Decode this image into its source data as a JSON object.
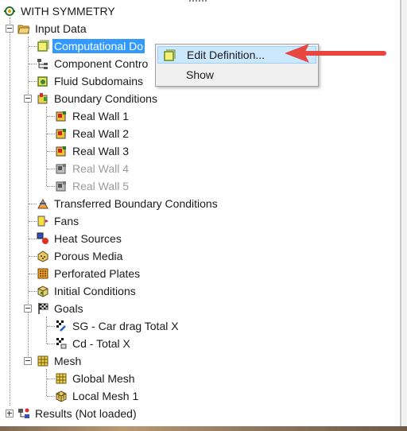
{
  "window": {
    "root_label": "WITH SYMMETRY"
  },
  "tree": {
    "input_data": "Input Data",
    "computational_domain": "Computational Do",
    "component_control": "Component Contro",
    "fluid_subdomains": "Fluid Subdomains",
    "boundary_conditions": "Boundary Conditions",
    "real_wall_1": "Real Wall 1",
    "real_wall_2": "Real Wall 2",
    "real_wall_3": "Real Wall 3",
    "real_wall_4": "Real Wall 4",
    "real_wall_5": "Real Wall 5",
    "transferred_bc": "Transferred Boundary Conditions",
    "fans": "Fans",
    "heat_sources": "Heat Sources",
    "porous_media": "Porous Media",
    "perforated_plates": "Perforated Plates",
    "initial_conditions": "Initial Conditions",
    "goals": "Goals",
    "goal_1": "SG - Car drag Total X",
    "goal_2": "Cd - Total X",
    "mesh": "Mesh",
    "global_mesh": "Global Mesh",
    "local_mesh_1": "Local Mesh 1",
    "results": "Results (Not loaded)"
  },
  "context_menu": {
    "edit_definition": "Edit Definition...",
    "show": "Show"
  },
  "colors": {
    "selection": "#3399ff",
    "menu_hover": "#cce8ff",
    "annotation_arrow": "#e8473f",
    "disabled_text": "#9a9a9a"
  }
}
